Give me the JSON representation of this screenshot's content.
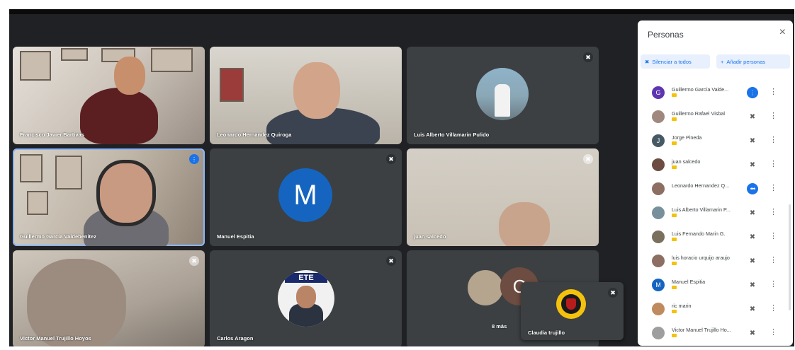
{
  "tiles": [
    {
      "name": "Francisco Javier Bartivas",
      "mic": "none"
    },
    {
      "name": "Leonardo Hernandez Quiroga",
      "mic": "none"
    },
    {
      "name": "Luis Alberto Villamarin Pulido",
      "mic": "muted"
    },
    {
      "name": "Guillermo García Valdebenitez",
      "mic": "speaking"
    },
    {
      "name": "Manuel Espitia",
      "mic": "muted",
      "avatar_letter": "M",
      "avatar_color": "#1565c0"
    },
    {
      "name": "juan salcedo",
      "mic": "muted"
    },
    {
      "name": "Victor Manuel Trujillo Hoyos",
      "mic": "muted"
    },
    {
      "name": "Carlos Aragon",
      "mic": "muted",
      "logo_text": "ETE"
    },
    {
      "name": "8 más",
      "mic": "none",
      "avatar_letter": "C",
      "avatar_color": "#6d4c41"
    }
  ],
  "floating_tile": {
    "name": "Claudia trujillo",
    "mic": "muted"
  },
  "panel": {
    "title": "Personas",
    "close": "×",
    "mute_all": "Silenciar a todos",
    "add_people": "Añadir personas",
    "people": [
      {
        "name": "Guillermo García Valde...",
        "avatar": "G",
        "color": "#5e35b1",
        "mic": "speaking"
      },
      {
        "name": "Guillermo Rafael Visbal",
        "avatar": "",
        "color": "#a1887f",
        "mic": "muted"
      },
      {
        "name": "Jorge Pineda",
        "avatar": "J",
        "color": "#455a64",
        "mic": "muted"
      },
      {
        "name": "juan salcedo",
        "avatar": "",
        "color": "#6d4c41",
        "mic": "muted"
      },
      {
        "name": "Leonardo Hernandez Q...",
        "avatar": "",
        "color": "#8d6e63",
        "mic": "dots"
      },
      {
        "name": "Luis Alberto Villamarin P...",
        "avatar": "",
        "color": "#78909c",
        "mic": "muted"
      },
      {
        "name": "Luis Fernando Marin G.",
        "avatar": "",
        "color": "#7b6f5e",
        "mic": "muted"
      },
      {
        "name": "luis horacio urquijo araujo",
        "avatar": "",
        "color": "#8d6e63",
        "mic": "muted"
      },
      {
        "name": "Manuel Espitia",
        "avatar": "M",
        "color": "#1565c0",
        "mic": "muted"
      },
      {
        "name": "ric marin",
        "avatar": "",
        "color": "#bf8b5e",
        "mic": "muted"
      },
      {
        "name": "Victor Manuel Trujillo Ho...",
        "avatar": "",
        "color": "#9e9e9e",
        "mic": "muted"
      }
    ]
  },
  "icons": {
    "mic_off": "mic-off-icon",
    "speaking": "audio-level-icon",
    "more": "more-vert-icon"
  }
}
